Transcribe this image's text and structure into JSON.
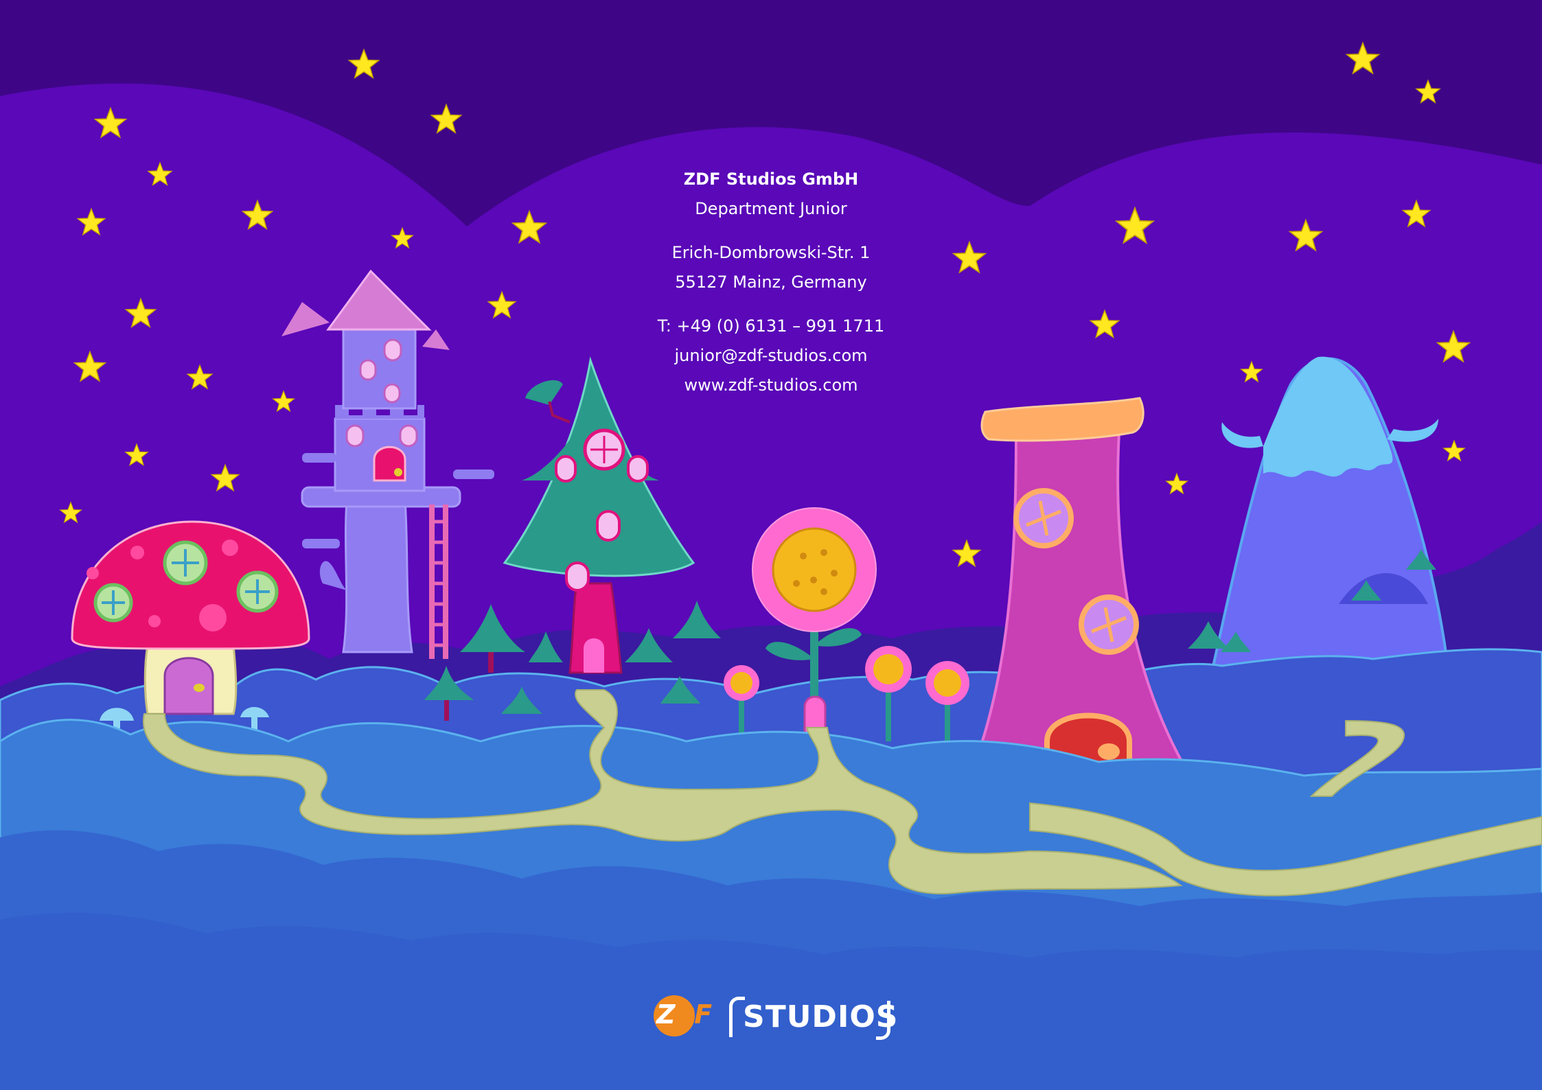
{
  "contact": {
    "company": "ZDF Studios GmbH",
    "department": "Department Junior",
    "street": "Erich-Dombrowski-Str. 1",
    "city": "55127 Mainz, Germany",
    "phone": "T: +49 (0) 6131 – 991 1711",
    "email": "junior@zdf-studios.com",
    "web": "www.zdf-studios.com"
  },
  "logo": {
    "zdf_z": "Z",
    "zdf_df": "DF",
    "studios": "STUDIOS"
  },
  "colors": {
    "sky_top": "#3f0587",
    "sky": "#5a08b8",
    "star": "#ffe81f",
    "hill_dark": "#3a1aa0",
    "hill_mid": "#3c57cf",
    "hill_light": "#3a7cd8",
    "path": "#c9cf90",
    "mushroom_cap": "#e8126e",
    "tower": "#8f7cf0",
    "tree": "#2a9a8a",
    "pink_tower": "#c93fb4",
    "mountain": "#6b6bf5",
    "snow": "#6fc8f5",
    "logo_orange": "#f08a1f"
  },
  "illustration": {
    "theme": "night fairy-tale landscape",
    "elements": [
      "stars-icon",
      "mushroom-house-icon",
      "castle-tower-icon",
      "tree-house-icon",
      "sunflower-house-icon",
      "pink-tower-house-icon",
      "snowy-mountain-icon",
      "winding-path-icon"
    ]
  }
}
